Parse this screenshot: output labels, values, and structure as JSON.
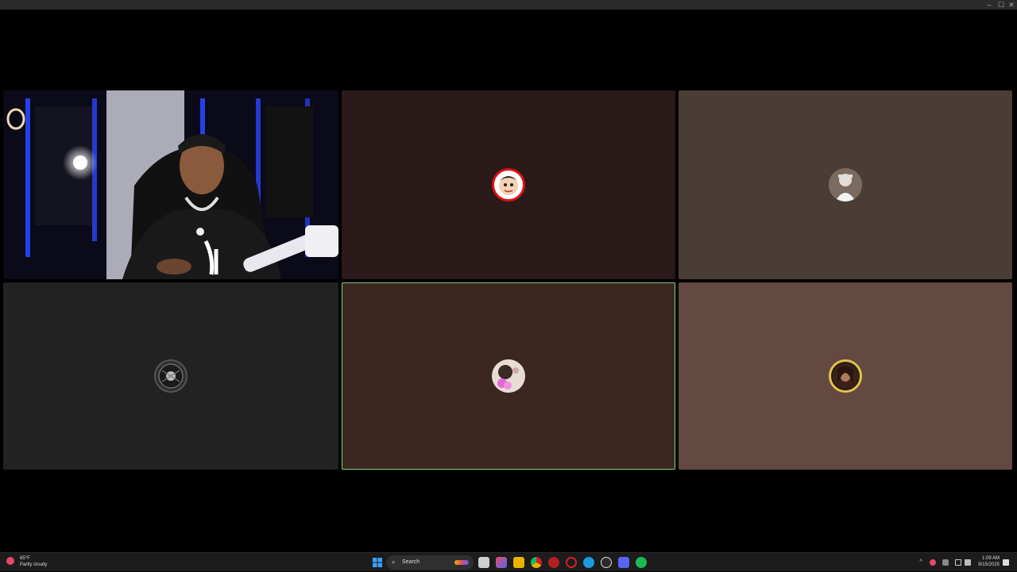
{
  "window": {
    "minimize_glyph": "–",
    "maximize_glyph": "☐",
    "close_glyph": "✕"
  },
  "call": {
    "tiles": [
      {
        "id": "camera-participant",
        "type": "video",
        "bg": "#0b0b14",
        "speaking": false
      },
      {
        "id": "participant-2",
        "type": "avatar",
        "bg": "#2a1a1a",
        "avatar": "cartoon-face-avatar",
        "ring": "#d11",
        "speaking": false
      },
      {
        "id": "participant-3",
        "type": "avatar",
        "bg": "#4a3d35",
        "avatar": "photo-avatar",
        "ring": "#888",
        "speaking": false
      },
      {
        "id": "participant-4",
        "type": "avatar",
        "bg": "#222222",
        "avatar": "dark-emblem-avatar",
        "ring": "#555",
        "speaking": false
      },
      {
        "id": "participant-5",
        "type": "avatar",
        "bg": "#3b2620",
        "avatar": "pink-flowers-avatar",
        "ring": "#cfa",
        "speaking": true
      },
      {
        "id": "participant-6",
        "type": "avatar",
        "bg": "#634940",
        "avatar": "gold-frame-avatar",
        "ring": "#e2c24a",
        "speaking": false
      }
    ]
  },
  "taskbar": {
    "weather_temp": "65°F",
    "weather_desc": "Partly cloudy",
    "search_label": "Search",
    "time": "1:09 AM",
    "date": "9/15/2025",
    "colors": {
      "start": "#3aa0ff",
      "spotify": "#1db954",
      "discord": "#5865f2",
      "chrome": "#e8b400",
      "edge": "#1a9be0",
      "opera": "#d21e2a"
    }
  }
}
